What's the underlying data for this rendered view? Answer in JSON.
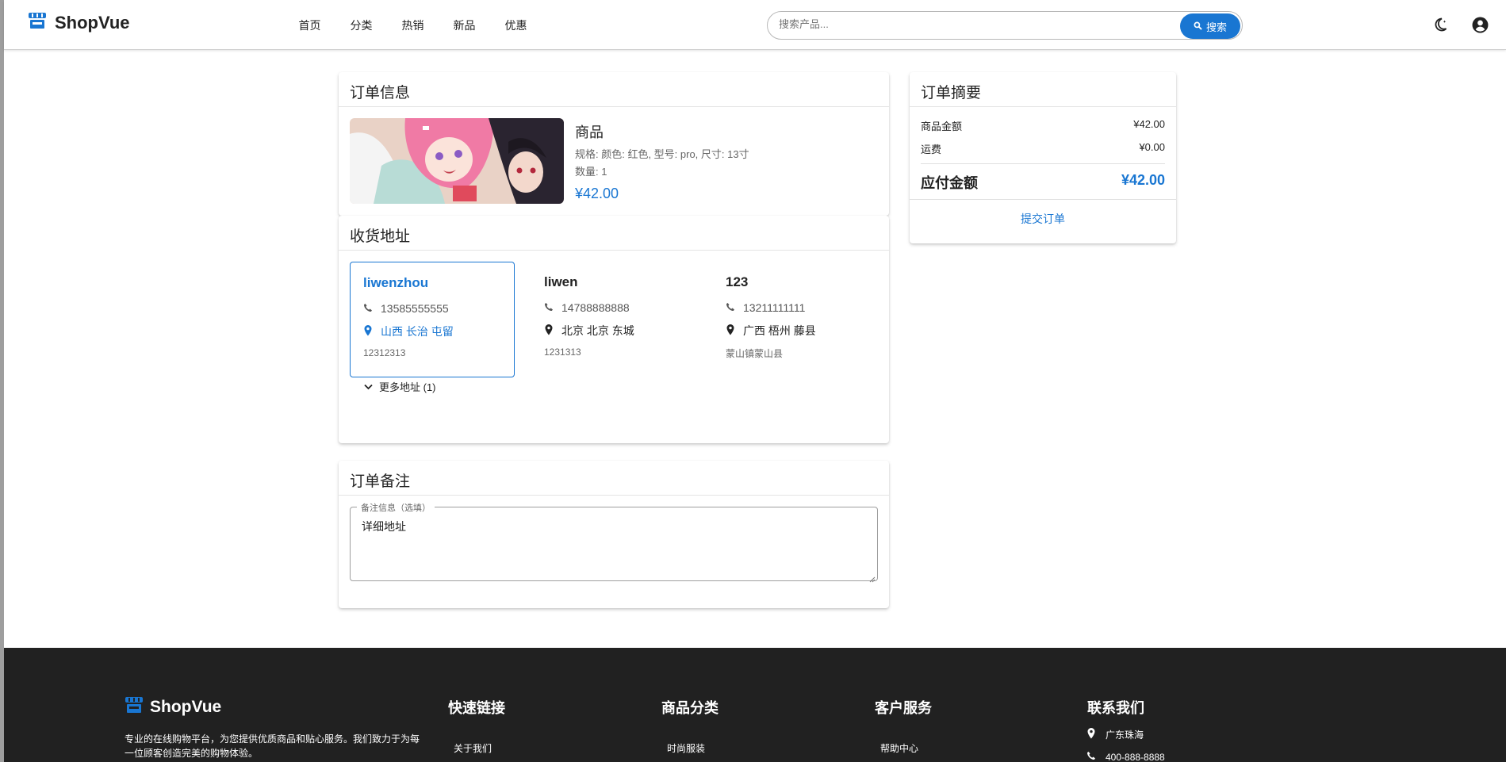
{
  "header": {
    "brand": "ShopVue",
    "nav": [
      "首页",
      "分类",
      "热销",
      "新品",
      "优惠"
    ],
    "search": {
      "placeholder": "搜索产品...",
      "button": "搜索"
    }
  },
  "order_info": {
    "title": "订单信息",
    "product": {
      "name": "商品",
      "spec": "规格: 颜色: 红色, 型号: pro, 尺寸: 13寸",
      "qty": "数量: 1",
      "price": "¥42.00"
    }
  },
  "addresses": {
    "title": "收货地址",
    "items": [
      {
        "name": "liwenzhou",
        "phone": "13585555555",
        "region": "山西 长治 屯留",
        "detail": "12312313",
        "selected": true
      },
      {
        "name": "liwen",
        "phone": "14788888888",
        "region": "北京 北京 东城",
        "detail": "1231313",
        "selected": false
      },
      {
        "name": "123",
        "phone": "13211111111",
        "region": "广西 梧州 藤县",
        "detail": "蒙山镇蒙山县",
        "selected": false
      }
    ],
    "more": "更多地址 (1)"
  },
  "notes": {
    "title": "订单备注",
    "label": "备注信息（选填）",
    "value": "详细地址"
  },
  "summary": {
    "title": "订单摘要",
    "goods_label": "商品金额",
    "goods_value": "¥42.00",
    "shipping_label": "运费",
    "shipping_value": "¥0.00",
    "total_label": "应付金额",
    "total_value": "¥42.00",
    "submit": "提交订单"
  },
  "footer": {
    "brand": "ShopVue",
    "desc": "专业的在线购物平台，为您提供优质商品和贴心服务。我们致力于为每一位顾客创造完美的购物体验。",
    "col_quick": "快速链接",
    "col_category": "商品分类",
    "col_service": "客户服务",
    "col_contact": "联系我们",
    "link_about": "关于我们",
    "link_fashion": "时尚服装",
    "link_help": "帮助中心",
    "contact_location": "广东珠海",
    "contact_phone": "400-888-8888"
  },
  "colors": {
    "accent": "#1976d2",
    "footer_bg": "#212121"
  }
}
